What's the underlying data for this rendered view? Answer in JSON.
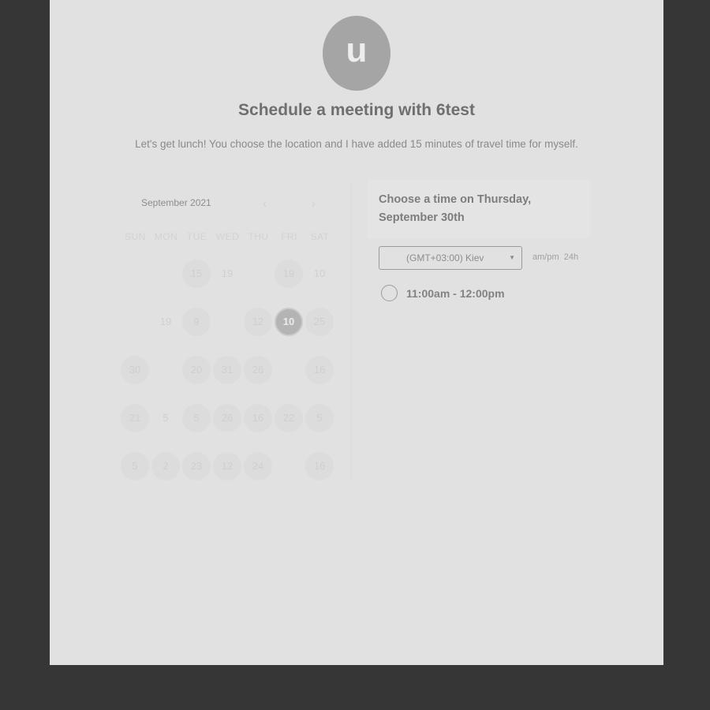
{
  "avatar": {
    "letter": "u"
  },
  "title": "Schedule a meeting with 6test",
  "description": "Let's get lunch! You choose the location and I have added 15 minutes of travel time for myself.",
  "calendar": {
    "month_label": "September 2021",
    "prev_icon": "chevron-left-icon",
    "next_icon": "chevron-right-icon",
    "prev_glyph": "‹",
    "next_glyph": "›",
    "weekdays": [
      "SUN",
      "MON",
      "TUE",
      "WED",
      "THU",
      "FRI",
      "SAT"
    ],
    "days": [
      {
        "label": "15",
        "row": 0,
        "col": 2,
        "state": "available"
      },
      {
        "label": "19",
        "row": 0,
        "col": 3,
        "state": "disabled"
      },
      {
        "label": "19",
        "row": 0,
        "col": 5,
        "state": "available"
      },
      {
        "label": "10",
        "row": 0,
        "col": 6,
        "state": "disabled"
      },
      {
        "label": "19",
        "row": 1,
        "col": 1,
        "state": "disabled"
      },
      {
        "label": "9",
        "row": 1,
        "col": 2,
        "state": "available"
      },
      {
        "label": "12",
        "row": 1,
        "col": 4,
        "state": "available"
      },
      {
        "label": "10",
        "row": 1,
        "col": 5,
        "state": "selected"
      },
      {
        "label": "25",
        "row": 1,
        "col": 6,
        "state": "available"
      },
      {
        "label": "30",
        "row": 2,
        "col": 0,
        "state": "available"
      },
      {
        "label": "20",
        "row": 2,
        "col": 2,
        "state": "available"
      },
      {
        "label": "31",
        "row": 2,
        "col": 3,
        "state": "available"
      },
      {
        "label": "26",
        "row": 2,
        "col": 4,
        "state": "available"
      },
      {
        "label": "16",
        "row": 2,
        "col": 6,
        "state": "available"
      },
      {
        "label": "21",
        "row": 3,
        "col": 0,
        "state": "available"
      },
      {
        "label": "5",
        "row": 3,
        "col": 1,
        "state": "disabled"
      },
      {
        "label": "5",
        "row": 3,
        "col": 2,
        "state": "available"
      },
      {
        "label": "26",
        "row": 3,
        "col": 3,
        "state": "available"
      },
      {
        "label": "16",
        "row": 3,
        "col": 4,
        "state": "available"
      },
      {
        "label": "22",
        "row": 3,
        "col": 5,
        "state": "available"
      },
      {
        "label": "5",
        "row": 3,
        "col": 6,
        "state": "available"
      },
      {
        "label": "5",
        "row": 4,
        "col": 0,
        "state": "available"
      },
      {
        "label": "2",
        "row": 4,
        "col": 1,
        "state": "available"
      },
      {
        "label": "23",
        "row": 4,
        "col": 2,
        "state": "available"
      },
      {
        "label": "12",
        "row": 4,
        "col": 3,
        "state": "available"
      },
      {
        "label": "24",
        "row": 4,
        "col": 4,
        "state": "available"
      },
      {
        "label": "16",
        "row": 4,
        "col": 6,
        "state": "available"
      }
    ]
  },
  "time_panel": {
    "heading": "Choose a time on Thursday, September 30th",
    "timezone": "(GMT+03:00) Kiev",
    "format_ampm": "am/pm",
    "format_24h": "24h",
    "slots": [
      "11:00am - 12:00pm"
    ]
  }
}
